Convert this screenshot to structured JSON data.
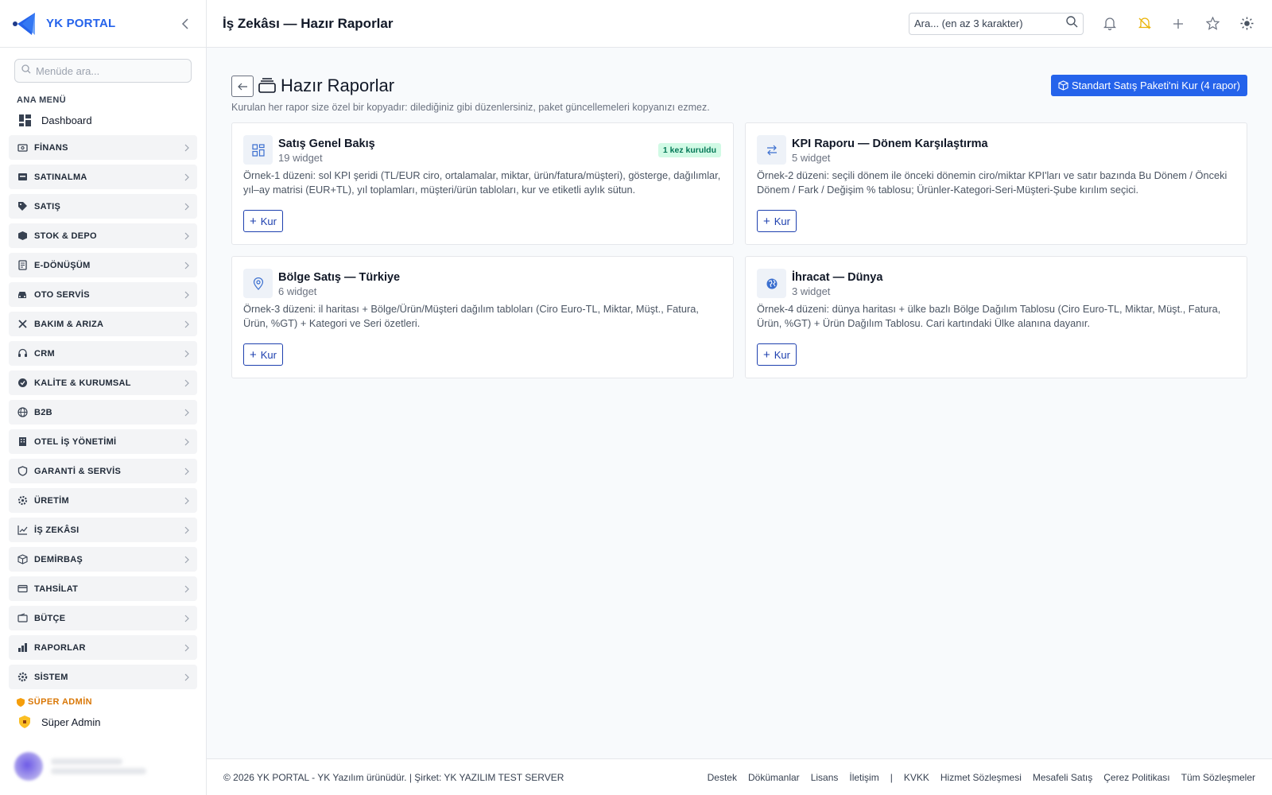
{
  "brand": {
    "name": "YK PORTAL"
  },
  "sidebar": {
    "search_placeholder": "Menüde ara...",
    "section_label": "ANA MENÜ",
    "dashboard_label": "Dashboard",
    "items": [
      {
        "label": "FİNANS",
        "icon": "finance-icon"
      },
      {
        "label": "SATINALMA",
        "icon": "cart-icon"
      },
      {
        "label": "SATIŞ",
        "icon": "tag-icon"
      },
      {
        "label": "STOK & DEPO",
        "icon": "box-icon"
      },
      {
        "label": "E-DÖNÜŞÜM",
        "icon": "document-icon"
      },
      {
        "label": "OTO SERVİS",
        "icon": "car-icon"
      },
      {
        "label": "BAKIM & ARIZA",
        "icon": "tools-icon"
      },
      {
        "label": "CRM",
        "icon": "headset-icon"
      },
      {
        "label": "KALİTE & KURUMSAL",
        "icon": "badge-check-icon"
      },
      {
        "label": "B2B",
        "icon": "globe-icon"
      },
      {
        "label": "OTEL İŞ YÖNETİMİ",
        "icon": "building-icon"
      },
      {
        "label": "GARANTİ & SERVİS",
        "icon": "shield-icon"
      },
      {
        "label": "ÜRETİM",
        "icon": "gear-icon"
      },
      {
        "label": "İŞ ZEKÂSI",
        "icon": "trend-icon"
      },
      {
        "label": "DEMİRBAŞ",
        "icon": "cube-icon"
      },
      {
        "label": "TAHSİLAT",
        "icon": "credit-card-icon"
      },
      {
        "label": "BÜTÇE",
        "icon": "wallet-icon"
      },
      {
        "label": "RAPORLAR",
        "icon": "bar-chart-icon"
      },
      {
        "label": "SİSTEM",
        "icon": "settings-icon"
      }
    ],
    "super_label": "SÜPER ADMİN",
    "super_item": "Süper Admin"
  },
  "topbar": {
    "title": "İş Zekâsı — Hazır Raporlar",
    "search_placeholder": "Ara... (en az 3 karakter)"
  },
  "page": {
    "title": "Hazır Raporlar",
    "subtitle": "Kurulan her rapor size özel bir kopyadır: dilediğiniz gibi düzenlersiniz, paket güncellemeleri kopyanızı ezmez.",
    "primary_button": "Standart Satış Paketi'ni Kur (4 rapor)"
  },
  "cards": [
    {
      "title": "Satış Genel Bakış",
      "count": "19 widget",
      "badge": "1 kez kuruldu",
      "description": "Örnek-1 düzeni: sol KPI şeridi (TL/EUR ciro, ortalamalar, miktar, ürün/fatura/müşteri), gösterge, dağılımlar, yıl–ay matrisi (EUR+TL), yıl toplamları, müşteri/ürün tabloları, kur ve etiketli aylık sütun.",
      "button": "Kur",
      "icon": "grid-icon"
    },
    {
      "title": "KPI Raporu — Dönem Karşılaştırma",
      "count": "5 widget",
      "badge": "",
      "description": "Örnek-2 düzeni: seçili dönem ile önceki dönemin ciro/miktar KPI'ları ve satır bazında Bu Dönem / Önceki Dönem / Fark / Değişim % tablosu; Ürünler-Kategori-Seri-Müşteri-Şube kırılım seçici.",
      "button": "Kur",
      "icon": "swap-icon"
    },
    {
      "title": "Bölge Satış — Türkiye",
      "count": "6 widget",
      "badge": "",
      "description": "Örnek-3 düzeni: il haritası + Bölge/Ürün/Müşteri dağılım tabloları (Ciro Euro-TL, Miktar, Müşt., Fatura, Ürün, %GT) + Kategori ve Seri özetleri.",
      "button": "Kur",
      "icon": "map-pin-icon"
    },
    {
      "title": "İhracat — Dünya",
      "count": "3 widget",
      "badge": "",
      "description": "Örnek-4 düzeni: dünya haritası + ülke bazlı Bölge Dağılım Tablosu (Ciro Euro-TL, Miktar, Müşt., Fatura, Ürün, %GT) + Ürün Dağılım Tablosu. Cari kartındaki Ülke alanına dayanır.",
      "button": "Kur",
      "icon": "globe-icon"
    }
  ],
  "footer": {
    "copyright": "© 2026 YK PORTAL - YK Yazılım ürünüdür. | Şirket: YK YAZILIM TEST SERVER",
    "links_left": [
      "Destek",
      "Dökümanlar",
      "Lisans",
      "İletişim"
    ],
    "separator": "|",
    "links_right": [
      "KVKK",
      "Hizmet Sözleşmesi",
      "Mesafeli Satış",
      "Çerez Politikası",
      "Tüm Sözleşmeler"
    ]
  },
  "colors": {
    "accent": "#2563eb",
    "badge_bg": "#d1fae5",
    "badge_text": "#047857",
    "super_admin": "#d97706"
  }
}
